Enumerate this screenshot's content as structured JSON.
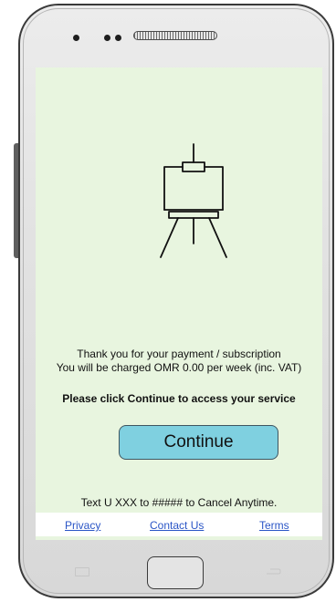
{
  "screen": {
    "background_color": "#e8f5df",
    "icon": "easel-icon",
    "message_line1": "Thank you for your payment / subscription",
    "message_line2": "You will be charged OMR 0.00 per week (inc. VAT)",
    "instruction": "Please click Continue to access your service",
    "continue_label": "Continue",
    "continue_color": "#7fd0e0",
    "cancel_text": "Text U XXX to ##### to Cancel Anytime.",
    "links": {
      "privacy": "Privacy",
      "contact": "Contact Us",
      "terms": "Terms",
      "link_color": "#2a55c6"
    }
  },
  "device": {
    "hardware_icons": [
      "camera-icon",
      "sensor-icon",
      "speaker-grille-icon",
      "menu-key-icon",
      "home-button-icon",
      "back-key-icon"
    ]
  }
}
